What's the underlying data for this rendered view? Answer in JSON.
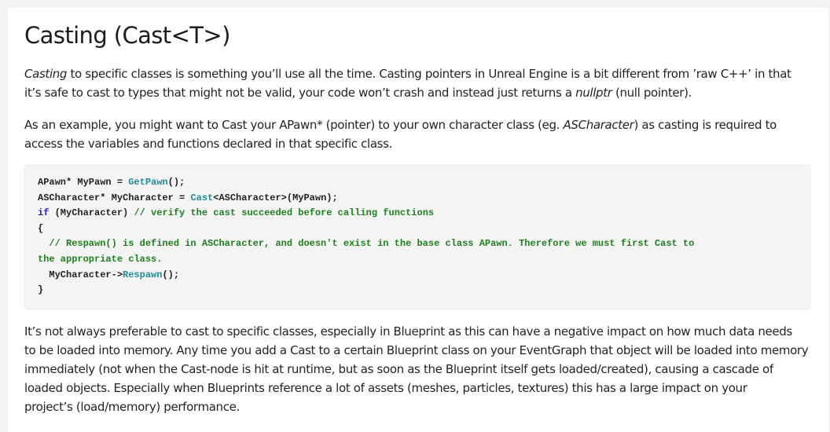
{
  "heading": "Casting (Cast<T>)",
  "p1": {
    "em1": "Casting",
    "t1": " to specific classes is something you’ll use all the time. Casting pointers in Unreal Engine is a bit different from ’raw C++’ in that",
    "t2": "it’s safe to cast to types that might not be valid, your code won’t crash and instead just returns a ",
    "em2": "nullptr",
    "t3": " (null pointer)."
  },
  "p2": {
    "t1": "As an example, you might want to Cast your APawn* (pointer) to your own character class (eg. ",
    "em1": "ASCharacter",
    "t2": ") as casting is required to",
    "t3": "access the variables and functions declared in that specific class."
  },
  "code": {
    "l1a": "APawn* MyPawn = ",
    "l1fn": "GetPawn",
    "l1b": "();",
    "l2a": "ASCharacter* MyCharacter = ",
    "l2fn": "Cast",
    "l2b": "<ASCharacter>(MyPawn);",
    "l3kw": "if",
    "l3a": " (MyCharacter) ",
    "l3cm": "// verify the cast succeeded before calling functions",
    "l4": "{",
    "l5cm": "  // Respawn() is defined in ASCharacter, and doesn't exist in the base class APawn. Therefore we must first Cast to",
    "l6cm": "the appropriate class.",
    "l7a": "  MyCharacter->",
    "l7fn": "Respawn",
    "l7b": "();",
    "l8": "}"
  },
  "p3": {
    "t1": "It’s not always preferable to cast to specific classes, especially in Blueprint as this can have a negative impact on how much data needs",
    "t2": "to be loaded into memory. Any time you add a Cast to a certain Blueprint class on your EventGraph that object will be loaded into memory",
    "t3": "immediately (not when the Cast-node is hit at runtime, but as soon as the Blueprint itself gets loaded/created), causing a cascade of",
    "t4": "loaded objects. Especially when Blueprints reference a lot of assets (meshes, particles, textures) this has a large impact on your",
    "t5": "project’s (load/memory) performance."
  }
}
